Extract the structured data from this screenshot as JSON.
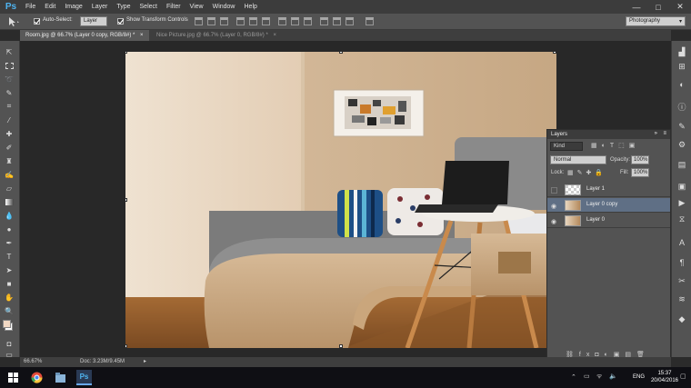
{
  "app": {
    "logo": "Ps",
    "brand_color": "#4fb4f0"
  },
  "menu": [
    "File",
    "Edit",
    "Image",
    "Layer",
    "Type",
    "Select",
    "Filter",
    "View",
    "Window",
    "Help"
  ],
  "window_controls": {
    "minimize": "—",
    "maximize": "□",
    "close": "✕"
  },
  "options": {
    "auto_select_label": "Auto-Select:",
    "auto_select_target": "Layer",
    "show_transform_label": "Show Transform Controls",
    "workspace": "Photography"
  },
  "tabs": [
    {
      "label": "Room.jpg @ 66.7% (Layer 0 copy, RGB/8#) *",
      "close": "×"
    },
    {
      "label": "Nice Picture.jpg @ 66.7% (Layer 0, RGB/8#) *",
      "close": "×"
    }
  ],
  "tools": [
    "move-tool",
    "marquee-tool",
    "lasso-tool",
    "quick-select-tool",
    "crop-tool",
    "eyedropper-tool",
    "healing-tool",
    "brush-tool",
    "stamp-tool",
    "history-brush-tool",
    "eraser-tool",
    "gradient-tool",
    "blur-tool",
    "dodge-tool",
    "pen-tool",
    "type-tool",
    "path-select-tool",
    "shape-tool",
    "hand-tool",
    "zoom-tool"
  ],
  "layers_panel": {
    "title": "Layers",
    "filter_kind": "Kind",
    "blend_mode": "Normal",
    "opacity_label": "Opacity:",
    "opacity_value": "100%",
    "lock_label": "Lock:",
    "fill_label": "Fill:",
    "fill_value": "100%",
    "layers": [
      {
        "name": "Layer 1",
        "visible": false,
        "selected": false
      },
      {
        "name": "Layer 0 copy",
        "visible": true,
        "selected": true
      },
      {
        "name": "Layer 0",
        "visible": true,
        "selected": false
      }
    ]
  },
  "status": {
    "zoom": "66.67%",
    "doc": "Doc: 3.23M/9.45M"
  },
  "taskbar": {
    "lang": "ENG",
    "time": "15:37",
    "date": "20/04/2016"
  },
  "colors": {
    "selection": "#5f6f85",
    "panel": "#535353",
    "workspace": "#282828"
  }
}
